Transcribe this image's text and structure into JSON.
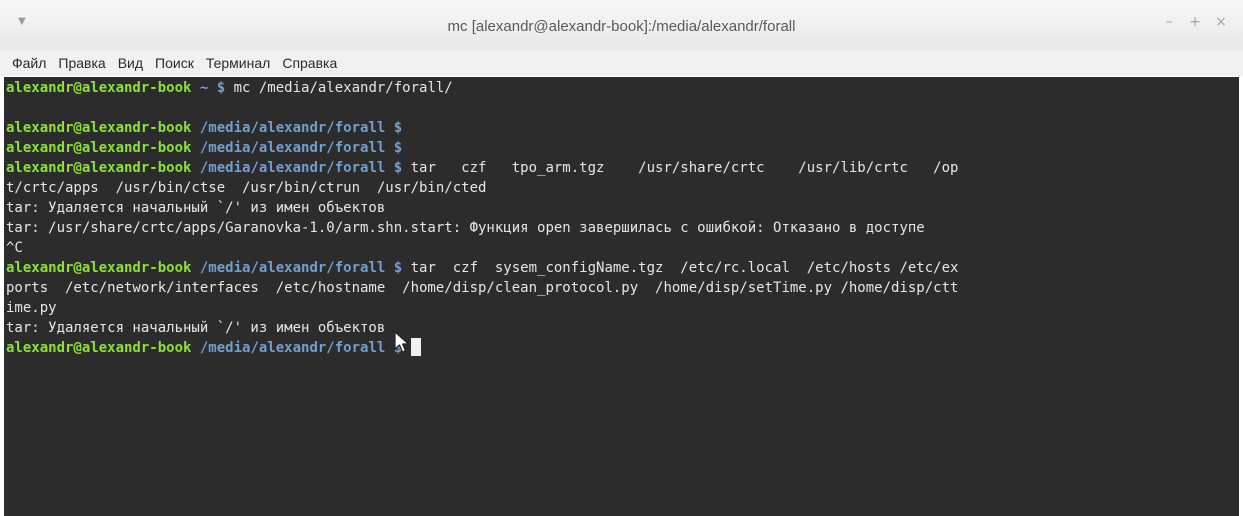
{
  "window": {
    "title": "mc [alexandr@alexandr-book]:/media/alexandr/forall",
    "menu_icon": "▼",
    "controls": {
      "minimize": "–",
      "maximize": "+",
      "close": "×"
    }
  },
  "menubar": {
    "items": [
      "Файл",
      "Правка",
      "Вид",
      "Поиск",
      "Терминал",
      "Справка"
    ]
  },
  "terminal": {
    "colors": {
      "background": "#2c2c2c",
      "user": "#8ae234",
      "path": "#729fcf",
      "text": "#e6e6e6"
    },
    "lines": [
      {
        "user": "alexandr@alexandr-book",
        "path": " ~ $",
        "text": " mc /media/alexandr/forall/"
      },
      {
        "text": ""
      },
      {
        "user": "alexandr@alexandr-book",
        "path": " /media/alexandr/forall $",
        "text": ""
      },
      {
        "user": "alexandr@alexandr-book",
        "path": " /media/alexandr/forall $",
        "text": ""
      },
      {
        "user": "alexandr@alexandr-book",
        "path": " /media/alexandr/forall $",
        "text": " tar   czf   tpo_arm.tgz    /usr/share/crtc    /usr/lib/crtc   /op"
      },
      {
        "text": "t/crtc/apps  /usr/bin/ctse  /usr/bin/ctrun  /usr/bin/cted"
      },
      {
        "text": "tar: Удаляется начальный `/' из имен объектов"
      },
      {
        "text": "tar: /usr/share/crtc/apps/Garanovka-1.0/arm.shn.start: Функция open завершилась с ошибкой: Отказано в доступе"
      },
      {
        "text": "^C"
      },
      {
        "user": "alexandr@alexandr-book",
        "path": " /media/alexandr/forall $",
        "text": " tar  czf  sysem_configName.tgz  /etc/rc.local  /etc/hosts /etc/ex"
      },
      {
        "text": "ports  /etc/network/interfaces  /etc/hostname  /home/disp/clean_protocol.py  /home/disp/setTime.py /home/disp/ctt"
      },
      {
        "text": "ime.py"
      },
      {
        "text": "tar: Удаляется начальный `/' из имен объектов"
      },
      {
        "user": "alexandr@alexandr-book",
        "path": " /media/alexandr/forall $",
        "text": " ",
        "cursor": true
      }
    ]
  }
}
